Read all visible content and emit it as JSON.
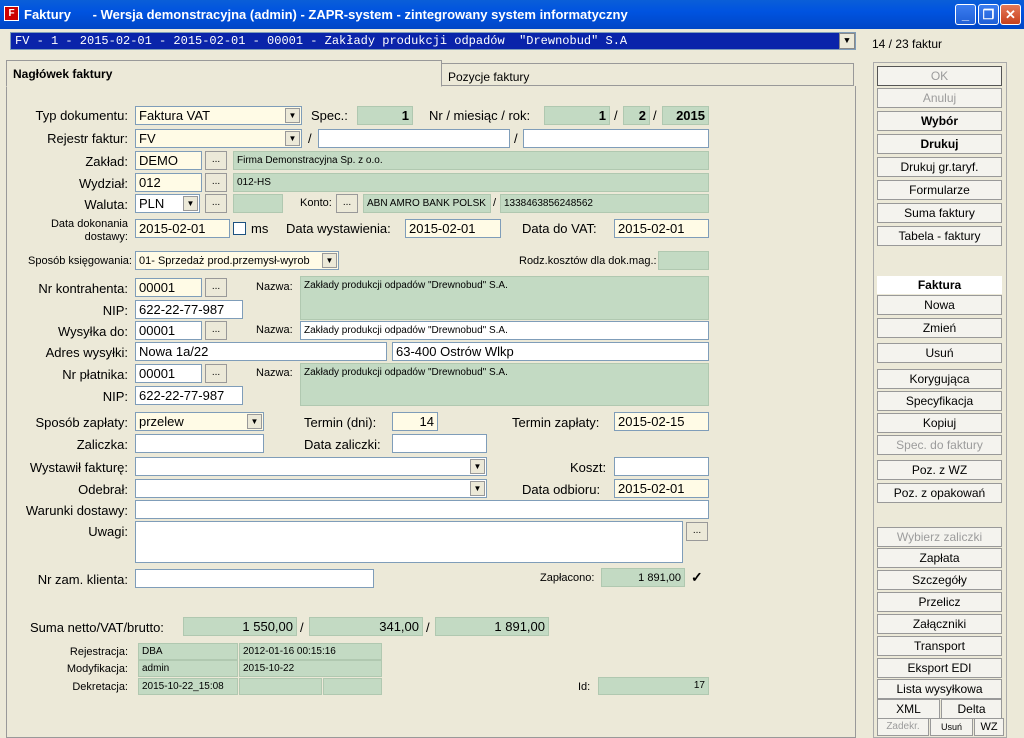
{
  "window": {
    "title": "Faktury      - Wersja demonstracyjna (admin) - ZAPR-system - zintegrowany system informatyczny"
  },
  "selector": {
    "value": "FV - 1 - 2015-02-01 - 2015-02-01 - 00001 - Zakłady produkcji odpadów  \"Drewnobud\" S.A",
    "counter": "14 / 23 faktur"
  },
  "tabs": [
    "Nagłówek faktury",
    "Pozycje faktury"
  ],
  "form": {
    "typ_label": "Typ dokumentu:",
    "typ_value": "Faktura VAT",
    "spec_label": "Spec.:",
    "spec_value": "1",
    "nr_label": "Nr / miesiąc / rok:",
    "nr_value": "1",
    "miesiac_value": "2",
    "rok_value": "2015",
    "rejestr_label": "Rejestr faktur:",
    "rejestr_value": "FV",
    "zaklad_label": "Zakład:",
    "zaklad_code": "DEMO",
    "zaklad_name": "Firma Demonstracyjna Sp. z o.o.",
    "wydzial_label": "Wydział:",
    "wydzial_code": "012",
    "wydzial_name": "012-HS",
    "waluta_label": "Waluta:",
    "waluta_value": "PLN",
    "konto_label": "Konto:",
    "bank_name": "ABN AMRO BANK POLSK",
    "bank_account": "1338463856248562",
    "data_dok_label": "Data dokonania dostawy:",
    "data_dok_value": "2015-02-01",
    "ms_label": "ms",
    "data_wyst_label": "Data wystawienia:",
    "data_wyst_value": "2015-02-01",
    "data_vat_label": "Data do VAT:",
    "data_vat_value": "2015-02-01",
    "ksieg_label": "Sposób księgowania:",
    "ksieg_value": "01- Sprzedaż prod.przemysł-wyrob",
    "rodz_label": "Rodz.kosztów dla dok.mag.:",
    "kontrahent_label": "Nr kontrahenta:",
    "kontrahent_value": "00001",
    "nazwa_label": "Nazwa:",
    "kontrahent_name": "Zakłady produkcji odpadów  \"Drewnobud\" S.A.",
    "nip_label": "NIP:",
    "nip_value": "622-22-77-987",
    "wysylka_label": "Wysyłka do:",
    "wysylka_value": "00001",
    "wysylka_name": "Zakłady produkcji odpadów  \"Drewnobud\" S.A.",
    "adres_label": "Adres wysyłki:",
    "adres_street": "Nowa 1a/22",
    "adres_city": "63-400 Ostrów Wlkp",
    "platnik_label": "Nr płatnika:",
    "platnik_value": "00001",
    "platnik_name": "Zakłady produkcji odpadów  \"Drewnobud\" S.A.",
    "nip2_value": "622-22-77-987",
    "zaplata_label": "Sposób zapłaty:",
    "zaplata_value": "przelew",
    "termin_dni_label": "Termin (dni):",
    "termin_dni_value": "14",
    "termin_zap_label": "Termin zapłaty:",
    "termin_zap_value": "2015-02-15",
    "zaliczka_label": "Zaliczka:",
    "data_zaliczki_label": "Data zaliczki:",
    "wystawil_label": "Wystawił fakturę:",
    "koszt_label": "Koszt:",
    "odebral_label": "Odebrał:",
    "data_odbioru_label": "Data odbioru:",
    "data_odbioru_value": "2015-02-01",
    "warunki_label": "Warunki dostawy:",
    "uwagi_label": "Uwagi:",
    "nr_zam_label": "Nr zam. klienta:",
    "zaplacono_label": "Zapłacono:",
    "zaplacono_value": "1 891,00",
    "suma_label": "Suma netto/VAT/brutto:",
    "netto": "1 550,00",
    "vat": "341,00",
    "brutto": "1 891,00",
    "rej_label": "Rejestracja:",
    "rej_user": "DBA",
    "rej_date": "2012-01-16 00:15:16",
    "mod_label": "Modyfikacja:",
    "mod_user": "admin",
    "mod_date": "2015-10-22",
    "dek_label": "Dekretacja:",
    "dek_value": "2015-10-22_15:08",
    "id_label": "Id:",
    "id_value": "17"
  },
  "sidebar": {
    "ok": "OK",
    "anuluj": "Anuluj",
    "wybor": "Wybór",
    "drukuj": "Drukuj",
    "drukuj_gr": "Drukuj gr.taryf.",
    "formularze": "Formularze",
    "suma": "Suma faktury",
    "tabela": "Tabela - faktury",
    "faktura_header": "Faktura",
    "nowa": "Nowa",
    "zmien": "Zmień",
    "usun": "Usuń",
    "korygujaca": "Korygująca",
    "specyfikacja": "Specyfikacja",
    "kopiuj": "Kopiuj",
    "spec_do": "Spec. do faktury",
    "poz_wz": "Poz. z WZ",
    "poz_opak": "Poz. z opakowań",
    "wybierz_zal": "Wybierz zaliczki",
    "zaplata": "Zapłata",
    "szczegoly": "Szczegóły",
    "przelicz": "Przelicz",
    "zalaczniki": "Załączniki",
    "transport": "Transport",
    "eksport": "Eksport EDI",
    "lista": "Lista wysyłkowa",
    "xml": "XML",
    "delta": "Delta",
    "zadekr": "Zadekr.",
    "usun_spec": "Usuń spec",
    "wz": "WZ"
  }
}
